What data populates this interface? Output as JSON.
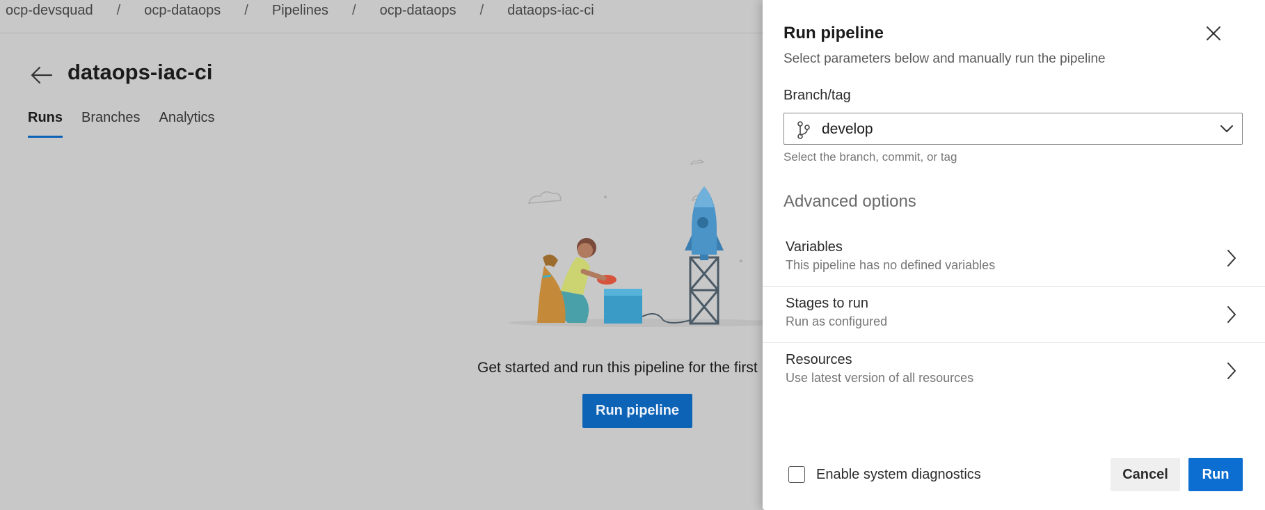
{
  "breadcrumb": [
    "ocp-devsquad",
    "ocp-dataops",
    "Pipelines",
    "ocp-dataops",
    "dataops-iac-ci"
  ],
  "breadcrumb_separator": "/",
  "page": {
    "title": "dataops-iac-ci",
    "tabs": [
      {
        "label": "Runs",
        "active": true
      },
      {
        "label": "Branches",
        "active": false
      },
      {
        "label": "Analytics",
        "active": false
      }
    ],
    "empty_state_text": "Get started and run this pipeline for the first",
    "run_pipeline_button": "Run pipeline"
  },
  "panel": {
    "title": "Run pipeline",
    "subtitle": "Select parameters below and manually run the pipeline",
    "branch_label": "Branch/tag",
    "branch_value": "develop",
    "branch_help": "Select the branch, commit, or tag",
    "advanced_heading": "Advanced options",
    "options": [
      {
        "title": "Variables",
        "desc": "This pipeline has no defined variables"
      },
      {
        "title": "Stages to run",
        "desc": "Run as configured"
      },
      {
        "title": "Resources",
        "desc": "Use latest version of all resources"
      }
    ],
    "diagnostics_label": "Enable system diagnostics",
    "diagnostics_checked": false,
    "cancel_label": "Cancel",
    "run_label": "Run"
  },
  "colors": {
    "primary": "#0b6ed0",
    "overlay_bg": "#c8c8c8",
    "tab_underline": "#0b61b6"
  },
  "icons": [
    "back-arrow-icon",
    "close-icon",
    "branch-icon",
    "chevron-down-icon",
    "chevron-right-icon"
  ]
}
